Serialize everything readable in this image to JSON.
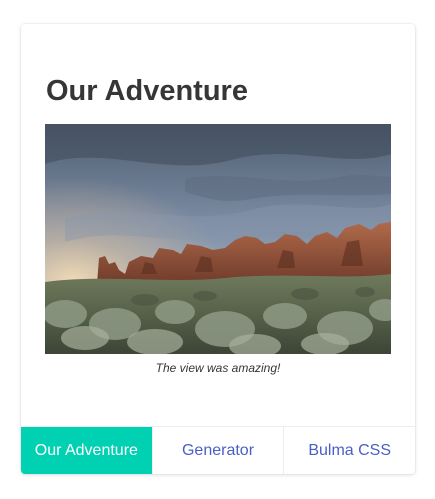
{
  "card": {
    "title": "Our Adventure",
    "image": {
      "subject": "desert rock formations under cloudy sky"
    },
    "caption": "The view was amazing!"
  },
  "footer": {
    "items": [
      {
        "label": "Our Adventure",
        "active": true
      },
      {
        "label": "Generator",
        "active": false
      },
      {
        "label": "Bulma CSS",
        "active": false
      }
    ]
  },
  "colors": {
    "accent": "#00d1b2",
    "link": "#485fc7",
    "title": "#363636"
  }
}
